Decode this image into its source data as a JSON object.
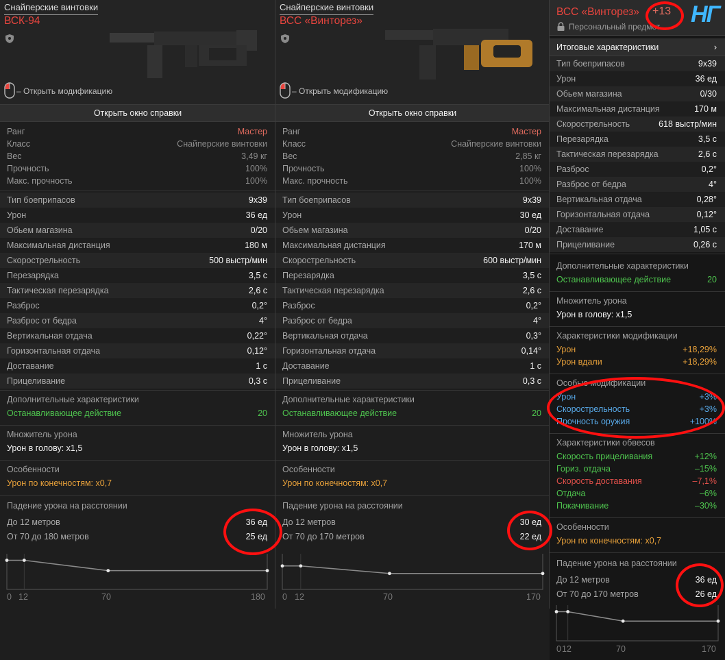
{
  "panels": [
    {
      "category": "Снайперские винтовки",
      "name": "ВСК-94",
      "mod_hint": "– Открыть модификацию",
      "help_button": "Открыть окно справки",
      "info": [
        {
          "label": "Ранг",
          "value": "Мастер"
        },
        {
          "label": "Класс",
          "value": "Снайперские винтовки"
        },
        {
          "label": "Вес",
          "value": "3,49 кг"
        },
        {
          "label": "Прочность",
          "value": "100%"
        },
        {
          "label": "Макс. прочность",
          "value": "100%"
        }
      ],
      "stats": [
        {
          "label": "Тип боеприпасов",
          "value": "9x39"
        },
        {
          "label": "Урон",
          "value": "36 ед"
        },
        {
          "label": "Обьем магазина",
          "value": "0/20"
        },
        {
          "label": "Максимальная дистанция",
          "value": "180 м"
        },
        {
          "label": "Скорострельность",
          "value": "500 выстр/мин"
        },
        {
          "label": "Перезарядка",
          "value": "3,5 с"
        },
        {
          "label": "Тактическая перезарядка",
          "value": "2,6 с"
        },
        {
          "label": "Разброс",
          "value": "0,2°"
        },
        {
          "label": "Разброс от бедра",
          "value": "4°"
        },
        {
          "label": "Вертикальная отдача",
          "value": "0,22°"
        },
        {
          "label": "Горизонтальная отдача",
          "value": "0,12°"
        },
        {
          "label": "Доставание",
          "value": "1 с"
        },
        {
          "label": "Прицеливание",
          "value": "0,3 с"
        }
      ],
      "extra_title": "Дополнительные характеристики",
      "extra_label": "Останавливающее действие",
      "extra_value": "20",
      "mult_title": "Множитель урона",
      "mult_value": "Урон в голову: x1,5",
      "feat_title": "Особенности",
      "feat_value": "Урон по конечностям: x0,7",
      "drop_title": "Падение урона на расстоянии",
      "drop_rows": [
        {
          "label": "До 12 метров",
          "value": "36 ед"
        },
        {
          "label": "От 70 до 180 метров",
          "value": "25 ед"
        }
      ],
      "ticks": [
        "0",
        "12",
        "70",
        "180"
      ]
    },
    {
      "category": "Снайперские винтовки",
      "name": "ВСС «Винторез»",
      "mod_hint": "– Открыть модификацию",
      "help_button": "Открыть окно справки",
      "info": [
        {
          "label": "Ранг",
          "value": "Мастер"
        },
        {
          "label": "Класс",
          "value": "Снайперские винтовки"
        },
        {
          "label": "Вес",
          "value": "2,85 кг"
        },
        {
          "label": "Прочность",
          "value": "100%"
        },
        {
          "label": "Макс. прочность",
          "value": "100%"
        }
      ],
      "stats": [
        {
          "label": "Тип боеприпасов",
          "value": "9x39"
        },
        {
          "label": "Урон",
          "value": "30 ед"
        },
        {
          "label": "Обьем магазина",
          "value": "0/20"
        },
        {
          "label": "Максимальная дистанция",
          "value": "170 м"
        },
        {
          "label": "Скорострельность",
          "value": "600 выстр/мин"
        },
        {
          "label": "Перезарядка",
          "value": "3,5 с"
        },
        {
          "label": "Тактическая перезарядка",
          "value": "2,6 с"
        },
        {
          "label": "Разброс",
          "value": "0,2°"
        },
        {
          "label": "Разброс от бедра",
          "value": "4°"
        },
        {
          "label": "Вертикальная отдача",
          "value": "0,3°"
        },
        {
          "label": "Горизонтальная отдача",
          "value": "0,14°"
        },
        {
          "label": "Доставание",
          "value": "1 с"
        },
        {
          "label": "Прицеливание",
          "value": "0,3 с"
        }
      ],
      "extra_title": "Дополнительные характеристики",
      "extra_label": "Останавливающее действие",
      "extra_value": "20",
      "mult_title": "Множитель урона",
      "mult_value": "Урон в голову: x1,5",
      "feat_title": "Особенности",
      "feat_value": "Урон по конечностям: x0,7",
      "drop_title": "Падение урона на расстоянии",
      "drop_rows": [
        {
          "label": "До 12 метров",
          "value": "30 ед"
        },
        {
          "label": "От 70 до 170 метров",
          "value": "22 ед"
        }
      ],
      "ticks": [
        "0",
        "12",
        "70",
        "170"
      ]
    }
  ],
  "right": {
    "name": "ВСС «Винторез»",
    "level": "+13",
    "personal": "Персональный предмет",
    "ng": "НГ",
    "summary_label": "Итоговые характеристики",
    "summary_arrow": "›",
    "stats": [
      {
        "label": "Тип боеприпасов",
        "value": "9x39"
      },
      {
        "label": "Урон",
        "value": "36 ед"
      },
      {
        "label": "Обьем магазина",
        "value": "0/30"
      },
      {
        "label": "Максимальная дистанция",
        "value": "170 м"
      },
      {
        "label": "Скорострельность",
        "value": "618 выстр/мин"
      },
      {
        "label": "Перезарядка",
        "value": "3,5 с"
      },
      {
        "label": "Тактическая перезарядка",
        "value": "2,6 с"
      },
      {
        "label": "Разброс",
        "value": "0,2°"
      },
      {
        "label": "Разброс от бедра",
        "value": "4°"
      },
      {
        "label": "Вертикальная отдача",
        "value": "0,28°"
      },
      {
        "label": "Горизонтальная отдача",
        "value": "0,12°"
      },
      {
        "label": "Доставание",
        "value": "1,05 с"
      },
      {
        "label": "Прицеливание",
        "value": "0,26 с"
      }
    ],
    "extra_title": "Дополнительные характеристики",
    "extra_label": "Останавливающее действие",
    "extra_value": "20",
    "mult_title": "Множитель урона",
    "mult_value": "Урон в голову: x1,5",
    "modchar_title": "Характеристики модификации",
    "modchar": [
      {
        "label": "Урон",
        "value": "+18,29%"
      },
      {
        "label": "Урон вдали",
        "value": "+18,29%"
      }
    ],
    "special_title": "Особые модификации",
    "special": [
      {
        "label": "Урон",
        "value": "+3%"
      },
      {
        "label": "Скорострельность",
        "value": "+3%"
      },
      {
        "label": "Прочность оружия",
        "value": "+100%"
      }
    ],
    "attach_title": "Характеристики обвесов",
    "attach": [
      {
        "label": "Скорость прицеливания",
        "value": "+12%"
      },
      {
        "label": "Гориз. отдача",
        "value": "–15%"
      },
      {
        "label": "Скорость доставания",
        "value": "–7,1%"
      },
      {
        "label": "Отдача",
        "value": "–6%"
      },
      {
        "label": "Покачивание",
        "value": "–30%"
      }
    ],
    "feat_title": "Особенности",
    "feat_value": "Урон по конечностям: x0,7",
    "drop_title": "Падение урона на расстоянии",
    "drop_rows": [
      {
        "label": "До 12 метров",
        "value": "36 ед"
      },
      {
        "label": "От 70 до 170 метров",
        "value": "26 ед"
      }
    ],
    "ticks": [
      "0",
      "12",
      "70",
      "170"
    ]
  },
  "chart_data": [
    {
      "type": "line",
      "x": [
        0,
        12,
        70,
        180
      ],
      "y": [
        36,
        36,
        25,
        25
      ],
      "xlim": [
        0,
        180
      ]
    },
    {
      "type": "line",
      "x": [
        0,
        12,
        70,
        170
      ],
      "y": [
        30,
        30,
        22,
        22
      ],
      "xlim": [
        0,
        170
      ]
    },
    {
      "type": "line",
      "x": [
        0,
        12,
        70,
        170
      ],
      "y": [
        36,
        36,
        26,
        26
      ],
      "xlim": [
        0,
        170
      ]
    }
  ]
}
